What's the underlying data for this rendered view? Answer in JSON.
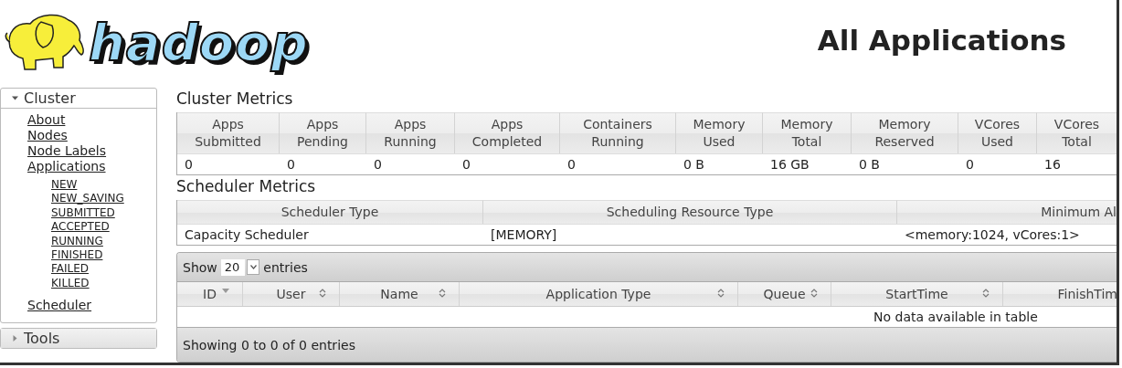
{
  "header": {
    "logo_text": "hadoop",
    "title": "All Applications"
  },
  "sidebar": {
    "sections": [
      {
        "label": "Cluster",
        "expanded": true,
        "links": [
          {
            "label": "About"
          },
          {
            "label": "Nodes"
          },
          {
            "label": "Node Labels"
          },
          {
            "label": "Applications",
            "children": [
              {
                "label": "NEW"
              },
              {
                "label": "NEW_SAVING"
              },
              {
                "label": "SUBMITTED"
              },
              {
                "label": "ACCEPTED"
              },
              {
                "label": "RUNNING"
              },
              {
                "label": "FINISHED"
              },
              {
                "label": "FAILED"
              },
              {
                "label": "KILLED"
              }
            ]
          },
          {
            "label": "Scheduler"
          }
        ]
      },
      {
        "label": "Tools",
        "expanded": false
      }
    ]
  },
  "cluster_metrics": {
    "title": "Cluster Metrics",
    "columns": [
      "Apps Submitted",
      "Apps Pending",
      "Apps Running",
      "Apps Completed",
      "Containers Running",
      "Memory Used",
      "Memory Total",
      "Memory Reserved",
      "VCores Used",
      "VCores Total"
    ],
    "values": [
      "0",
      "0",
      "0",
      "0",
      "0",
      "0 B",
      "16 GB",
      "0 B",
      "0",
      "16"
    ]
  },
  "scheduler_metrics": {
    "title": "Scheduler Metrics",
    "columns": [
      "Scheduler Type",
      "Scheduling Resource Type",
      "Minimum Al"
    ],
    "row": [
      "Capacity Scheduler",
      "[MEMORY]",
      "<memory:1024, vCores:1>"
    ]
  },
  "applications": {
    "show_label": "Show",
    "page_size": "20",
    "entries_label": "entries",
    "columns": [
      {
        "label": "ID",
        "sorted": true
      },
      {
        "label": "User",
        "sorted": false
      },
      {
        "label": "Name",
        "sorted": false
      },
      {
        "label": "Application Type",
        "sorted": false
      },
      {
        "label": "Queue",
        "sorted": false
      },
      {
        "label": "StartTime",
        "sorted": false
      },
      {
        "label": "FinishTim"
      }
    ],
    "empty_message": "No data available in table",
    "info": "Showing 0 to 0 of 0 entries"
  }
}
